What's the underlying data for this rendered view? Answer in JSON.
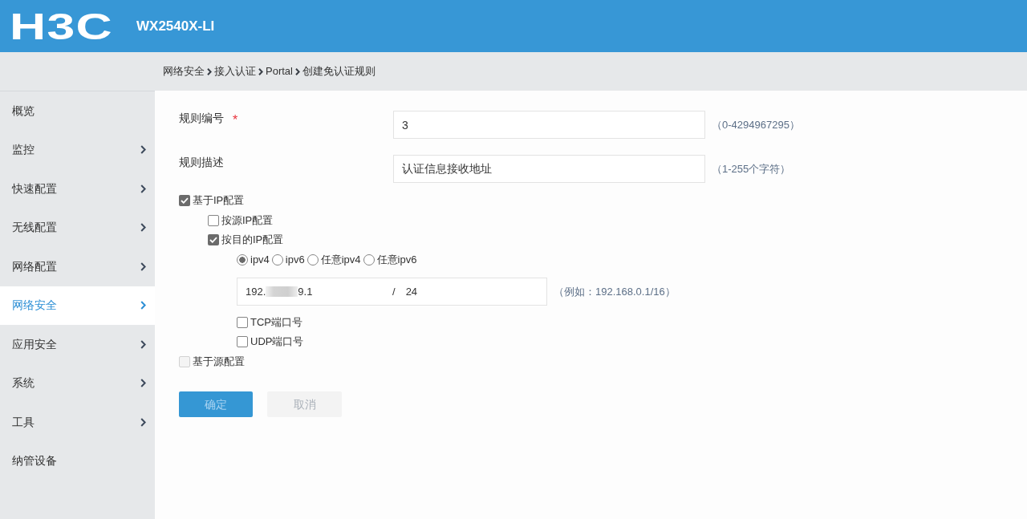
{
  "header": {
    "logo": "H3C",
    "title": "WX2540X-LI"
  },
  "breadcrumb": [
    "网络安全",
    "接入认证",
    "Portal",
    "创建免认证规则"
  ],
  "sidebar": {
    "items": [
      {
        "label": "概览",
        "expandable": false,
        "selected": false
      },
      {
        "label": "监控",
        "expandable": true,
        "selected": false
      },
      {
        "label": "快速配置",
        "expandable": true,
        "selected": false
      },
      {
        "label": "无线配置",
        "expandable": true,
        "selected": false
      },
      {
        "label": "网络配置",
        "expandable": true,
        "selected": false
      },
      {
        "label": "网络安全",
        "expandable": true,
        "selected": true
      },
      {
        "label": "应用安全",
        "expandable": true,
        "selected": false
      },
      {
        "label": "系统",
        "expandable": true,
        "selected": false
      },
      {
        "label": "工具",
        "expandable": true,
        "selected": false
      },
      {
        "label": "纳管设备",
        "expandable": false,
        "selected": false
      }
    ]
  },
  "form": {
    "fields": [
      {
        "label": "规则编号",
        "required_mark": "*",
        "value": "3",
        "hint": "（0-4294967295）"
      },
      {
        "label": "规则描述",
        "value": "认证信息接收地址",
        "hint": "（1-255个字符）"
      }
    ],
    "options": [
      {
        "kind": "checkbox",
        "label": "基于IP配置",
        "checked": true,
        "disabled": false,
        "children": [
          {
            "kind": "checkbox",
            "label": "按源IP配置",
            "checked": false,
            "disabled": false
          },
          {
            "kind": "checkbox",
            "label": "按目的IP配置",
            "checked": true,
            "disabled": false,
            "children": [
              {
                "kind": "radio_group",
                "options": [
                  {
                    "label": "ipv4",
                    "selected": true
                  },
                  {
                    "label": "ipv6",
                    "selected": false
                  },
                  {
                    "label": "任意ipv4",
                    "selected": false
                  },
                  {
                    "label": "任意ipv6",
                    "selected": false
                  }
                ]
              },
              {
                "kind": "ip_field",
                "address_start": "192.",
                "address_end": "9.1",
                "separator": "/",
                "prefix_length": "24",
                "hint": "（例如：192.168.0.1/16）"
              },
              {
                "kind": "checkbox",
                "label": "TCP端口号",
                "checked": false,
                "disabled": false
              },
              {
                "kind": "checkbox",
                "label": "UDP端口号",
                "checked": false,
                "disabled": false
              }
            ]
          }
        ]
      },
      {
        "kind": "checkbox",
        "label": "基于源配置",
        "checked": false,
        "disabled": true
      }
    ],
    "buttons": [
      {
        "label": "确定",
        "kind": "primary",
        "disabled": true
      },
      {
        "label": "取消",
        "kind": "secondary",
        "disabled": true
      }
    ]
  }
}
